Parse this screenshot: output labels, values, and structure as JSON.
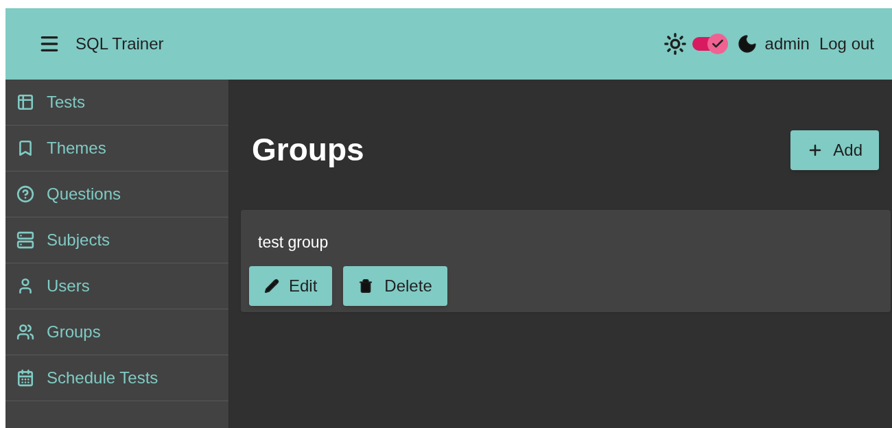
{
  "header": {
    "title": "SQL Trainer",
    "theme_switch": {
      "on": true
    },
    "user": "admin",
    "logout": "Log out"
  },
  "sidebar": {
    "items": [
      {
        "label": "Tests"
      },
      {
        "label": "Themes"
      },
      {
        "label": "Questions"
      },
      {
        "label": "Subjects"
      },
      {
        "label": "Users"
      },
      {
        "label": "Groups"
      },
      {
        "label": "Schedule Tests"
      }
    ]
  },
  "page": {
    "title": "Groups",
    "add_button": "Add",
    "groups": [
      {
        "name": "test group",
        "edit": "Edit",
        "delete": "Delete"
      }
    ]
  }
}
